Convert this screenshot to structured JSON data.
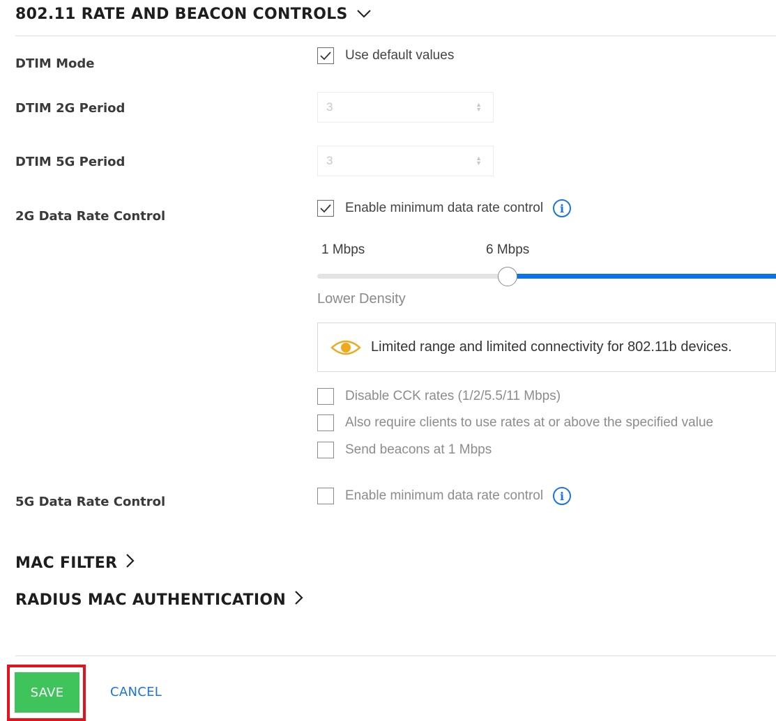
{
  "rate_beacon": {
    "title": "802.11 RATE AND BEACON CONTROLS",
    "expand_icon": "chevron-down-icon",
    "dtim_mode": {
      "label": "DTIM Mode",
      "checkbox_label": "Use default values",
      "checked": true
    },
    "dtim_2g": {
      "label": "DTIM 2G Period",
      "value": "3"
    },
    "dtim_5g": {
      "label": "DTIM 5G Period",
      "value": "3"
    },
    "rate_2g": {
      "label": "2G Data Rate Control",
      "checkbox_label": "Enable minimum data rate control",
      "checked": true,
      "info_icon": "info-icon",
      "slider": {
        "min_label": "1 Mbps",
        "value_label": "6 Mbps",
        "density_label": "Lower Density",
        "position_fraction": 0.42
      },
      "warning": {
        "icon": "eye-icon",
        "text": "Limited range and limited connectivity for 802.11b devices."
      },
      "options": [
        {
          "label": "Disable CCK rates (1/2/5.5/11 Mbps)",
          "checked": false
        },
        {
          "label": "Also require clients to use rates at or above the specified value",
          "checked": false
        },
        {
          "label": "Send beacons at 1 Mbps",
          "checked": false
        }
      ]
    },
    "rate_5g": {
      "label": "5G Data Rate Control",
      "checkbox_label": "Enable minimum data rate control",
      "checked": false,
      "info_icon": "info-icon"
    }
  },
  "mac_filter": {
    "title": "MAC FILTER",
    "icon": "chevron-right-icon"
  },
  "radius_mac": {
    "title": "RADIUS MAC AUTHENTICATION",
    "icon": "chevron-right-icon"
  },
  "actions": {
    "save_label": "SAVE",
    "cancel_label": "CANCEL"
  },
  "colors": {
    "accent": "#1a73e8",
    "slider_fill": "#0a72e8",
    "save": "#3fc45b",
    "highlight": "#e0141e",
    "warning_icon": "#f0a81c"
  }
}
